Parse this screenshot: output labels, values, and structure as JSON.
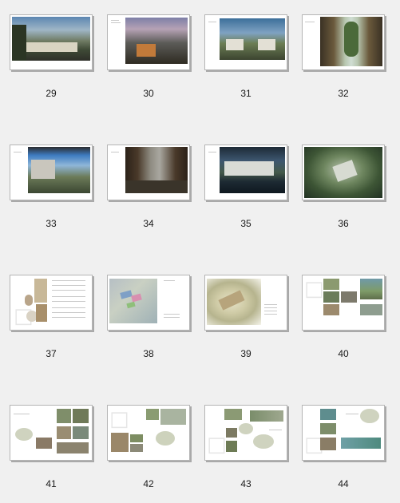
{
  "pages": [
    {
      "number": "29",
      "kind": "full-render"
    },
    {
      "number": "30",
      "kind": "full-render"
    },
    {
      "number": "31",
      "kind": "full-render"
    },
    {
      "number": "32",
      "kind": "corridor-render"
    },
    {
      "number": "33",
      "kind": "full-render"
    },
    {
      "number": "34",
      "kind": "courtyard-render"
    },
    {
      "number": "35",
      "kind": "waterfront-render"
    },
    {
      "number": "36",
      "kind": "aerial-render"
    },
    {
      "number": "37",
      "kind": "text-collage"
    },
    {
      "number": "38",
      "kind": "site-plan"
    },
    {
      "number": "39",
      "kind": "site-plan-text"
    },
    {
      "number": "40",
      "kind": "photo-grid"
    },
    {
      "number": "41",
      "kind": "sketch-photos"
    },
    {
      "number": "42",
      "kind": "sketch-photos"
    },
    {
      "number": "43",
      "kind": "sketch-photos"
    },
    {
      "number": "44",
      "kind": "sketch-photos"
    }
  ],
  "colors": {
    "background": "#f0f0f0",
    "page_border": "#b5b5b5",
    "shadow": "#a9a9a9"
  }
}
